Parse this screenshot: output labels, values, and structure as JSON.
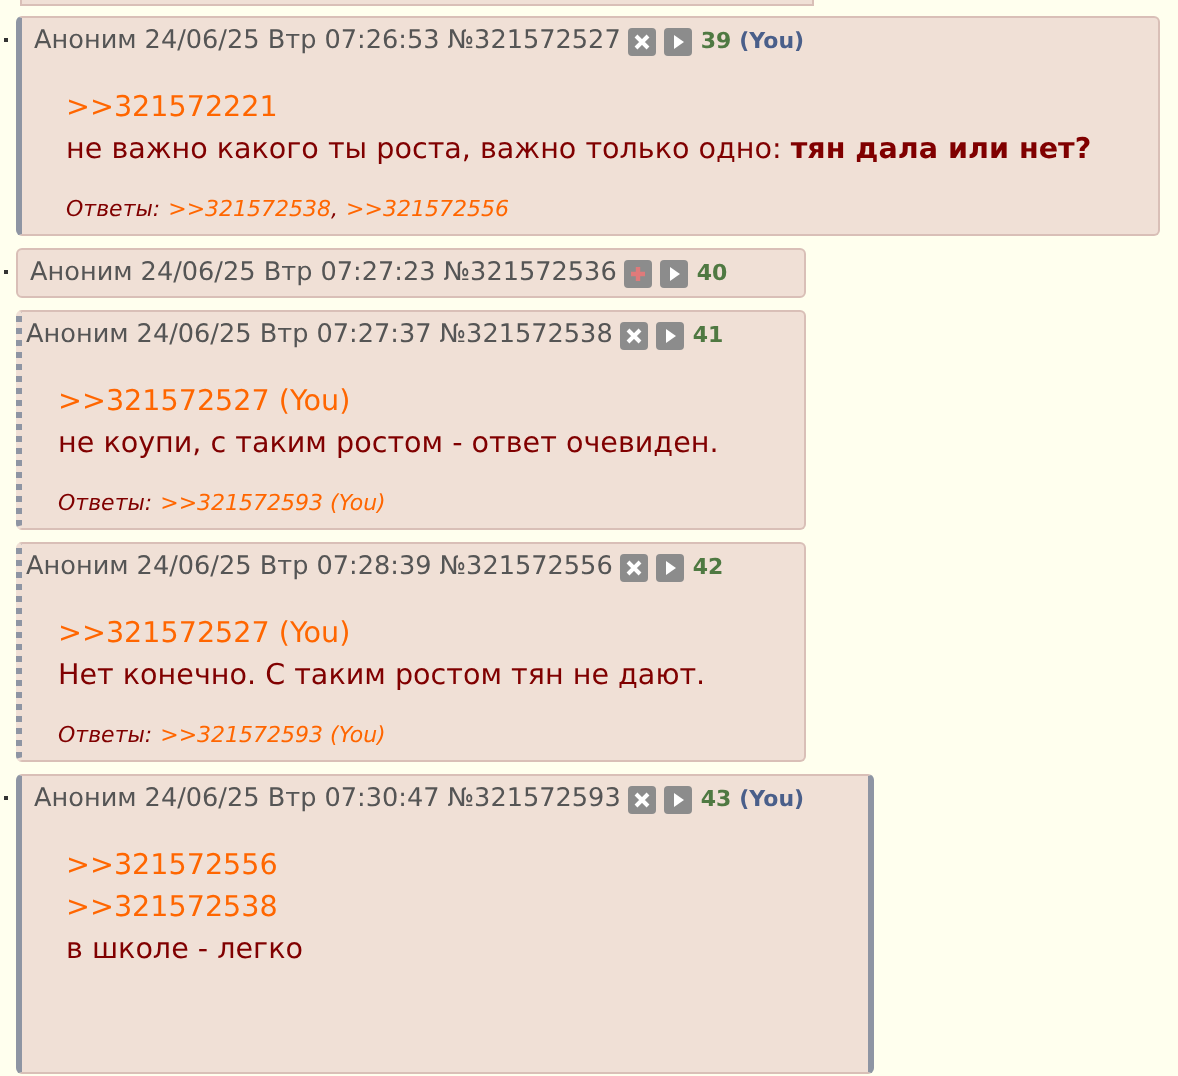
{
  "posts": [
    {
      "name": "Аноним",
      "date": "24/06/25 Втр 07:26:53",
      "number": "№321572527",
      "count": "39",
      "you": "(You)",
      "own": true,
      "quotes_you": false,
      "highlighted": false,
      "collapsed": false,
      "body": [
        {
          "kind": "link",
          "text": ">>321572221"
        },
        {
          "kind": "text",
          "text": "не важно какого ты роста, важно только одно: **тян дала или нет?**"
        }
      ],
      "replies_label": "Ответы:",
      "replies": [
        ">>321572538",
        ">>321572556"
      ],
      "replies_separator": ","
    },
    {
      "name": "Аноним",
      "date": "24/06/25 Втр 07:27:23",
      "number": "№321572536",
      "count": "40",
      "own": false,
      "quotes_you": false,
      "highlighted": false,
      "collapsed": true
    },
    {
      "name": "Аноним",
      "date": "24/06/25 Втр 07:27:37",
      "number": "№321572538",
      "count": "41",
      "own": false,
      "quotes_you": true,
      "highlighted": false,
      "collapsed": false,
      "body": [
        {
          "kind": "link",
          "text": ">>321572527 (You)"
        },
        {
          "kind": "text",
          "text": "не коупи, с таким ростом - ответ очевиден."
        }
      ],
      "replies_label": "Ответы:",
      "replies": [
        ">>321572593 (You)"
      ]
    },
    {
      "name": "Аноним",
      "date": "24/06/25 Втр 07:28:39",
      "number": "№321572556",
      "count": "42",
      "own": false,
      "quotes_you": true,
      "highlighted": false,
      "collapsed": false,
      "body": [
        {
          "kind": "link",
          "text": ">>321572527 (You)"
        },
        {
          "kind": "text",
          "text": "Нет конечно. С таким ростом тян не дают."
        }
      ],
      "replies_label": "Ответы:",
      "replies": [
        ">>321572593 (You)"
      ]
    },
    {
      "name": "Аноним",
      "date": "24/06/25 Втр 07:30:47",
      "number": "№321572593",
      "count": "43",
      "you": "(You)",
      "own": true,
      "quotes_you": false,
      "highlighted": true,
      "collapsed": false,
      "body": [
        {
          "kind": "link",
          "text": ">>321572556"
        },
        {
          "kind": "link",
          "text": ">>321572538"
        },
        {
          "kind": "text",
          "text": "в школе - легко"
        }
      ]
    }
  ]
}
